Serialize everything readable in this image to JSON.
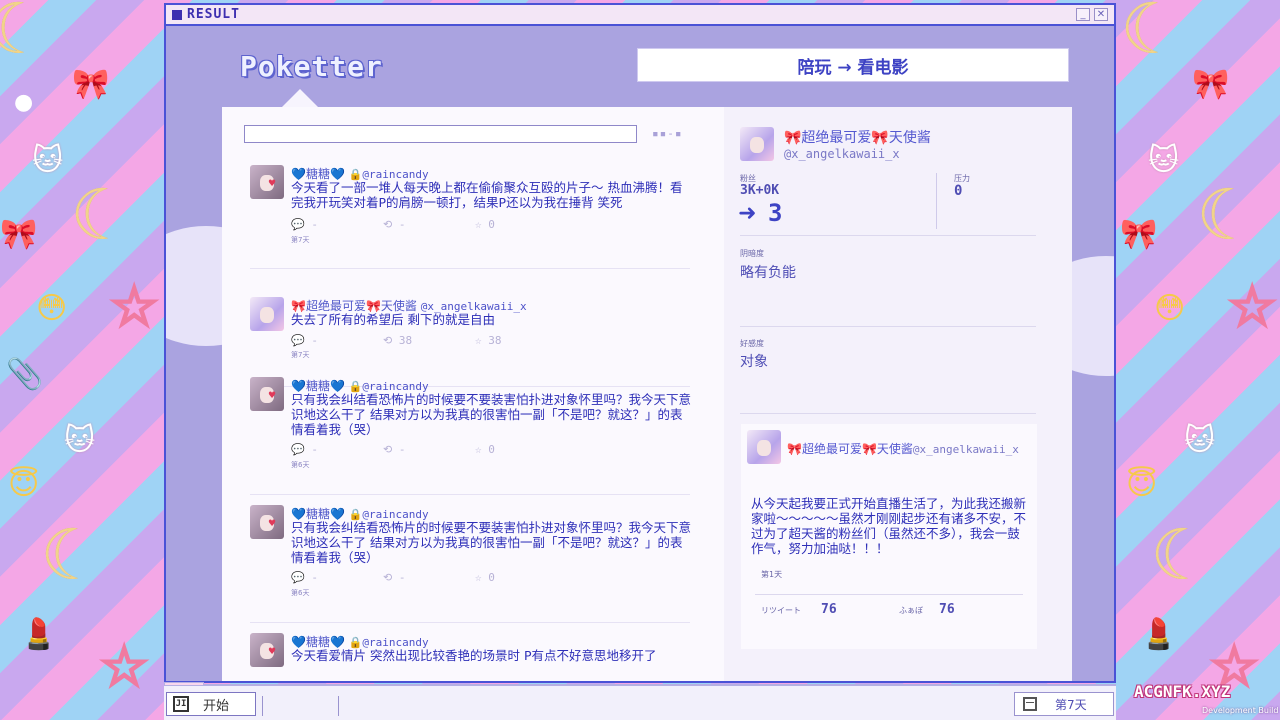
{
  "window": {
    "title": "RESULT"
  },
  "app": {
    "name": "Poketter",
    "task": "陪玩 → 看电影"
  },
  "search": {
    "value": ""
  },
  "feed": [
    {
      "name": "💙糖糖💙",
      "handle": "🔒@raincandy",
      "avatar": "ame",
      "text": "今天看了一部一堆人每天晚上都在偷偷聚众互殴的片子～ 热血沸腾！看完我开玩笑对着P的肩膀一顿打，结果P还以为我在捶背 笑死",
      "replies": "-",
      "retweets": "-",
      "likes": "0",
      "day": "第7天"
    },
    {
      "name": "🎀超绝最可爱🎀天使酱",
      "handle": "@x_angelkawaii_x",
      "avatar": "angel",
      "text": "失去了所有的希望后 剩下的就是自由",
      "replies": "-",
      "retweets": "38",
      "likes": "38",
      "day": "第7天"
    },
    {
      "name": "💙糖糖💙",
      "handle": "🔒@raincandy",
      "avatar": "ame",
      "text": "只有我会纠结看恐怖片的时候要不要装害怕扑进对象怀里吗？我今天下意识地这么干了 结果对方以为我真的很害怕一副「不是吧？就这？」的表情看着我（哭）",
      "replies": "-",
      "retweets": "-",
      "likes": "0",
      "day": "第6天"
    },
    {
      "name": "💙糖糖💙",
      "handle": "🔒@raincandy",
      "avatar": "ame",
      "text": "只有我会纠结看恐怖片的时候要不要装害怕扑进对象怀里吗？我今天下意识地这么干了 结果对方以为我真的很害怕一副「不是吧？就这？」的表情看着我（哭）",
      "replies": "-",
      "retweets": "-",
      "likes": "0",
      "day": "第6天"
    },
    {
      "name": "💙糖糖💙",
      "handle": "🔒@raincandy",
      "avatar": "ame",
      "text": "今天看爱情片 突然出现比较香艳的场景时 P有点不好意思地移开了",
      "replies": "",
      "retweets": "",
      "likes": "",
      "day": ""
    }
  ],
  "profile": {
    "name": "🎀超绝最可爱🎀天使酱",
    "handle": "@x_angelkawaii_x",
    "followers_label": "粉丝",
    "followers_value": "3K+0K",
    "followers_delta": "3",
    "stress_label": "压力",
    "stress_value": "0",
    "affection_label": "阴暗度",
    "affection_value": "略有负能",
    "goodwill_label": "好感度",
    "goodwill_value": "对象"
  },
  "pinned": {
    "name": "🎀超绝最可爱🎀天使酱",
    "handle": "@x_angelkawaii_x",
    "text": "从今天起我要正式开始直播生活了，为此我还搬新家啦～～～～～虽然才刚刚起步还有诸多不安，不过为了超天酱的粉丝们（虽然还不多），我会一鼓作气，努力加油哒！！！",
    "day": "第1天",
    "retweet_label": "リツイート",
    "retweet_value": "76",
    "like_label": "ふぁぼ",
    "like_value": "76"
  },
  "taskbar": {
    "start_label": "开始",
    "day_label": "第7天"
  },
  "watermark": {
    "site": "ACGNFK.XYZ",
    "build": "Development Build"
  },
  "colors": {
    "accent": "#4a52d6",
    "text": "#2e2fb8",
    "panel": "#f7f4fd"
  }
}
